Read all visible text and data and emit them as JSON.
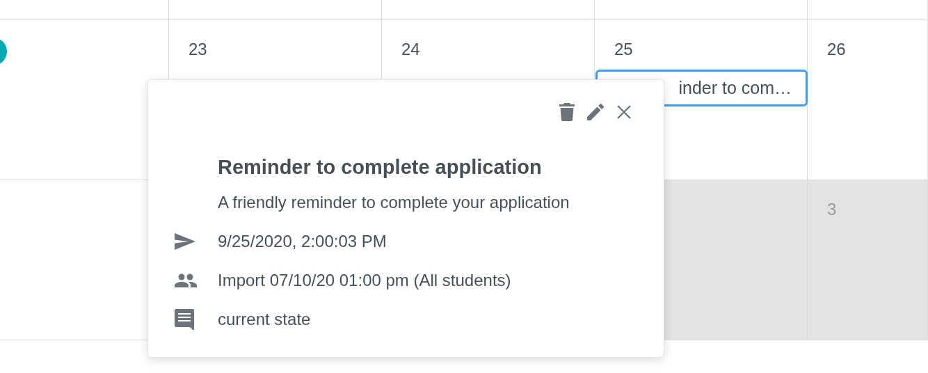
{
  "calendar": {
    "weeks": [
      {
        "cells": [
          {
            "outside": false
          },
          {
            "outside": false
          },
          {
            "outside": false
          },
          {
            "outside": false
          },
          {
            "outside": false
          }
        ]
      },
      {
        "cells": [
          {
            "outside": false,
            "marker": true
          },
          {
            "outside": false,
            "day": "23"
          },
          {
            "outside": false,
            "day": "24"
          },
          {
            "outside": false,
            "day": "25",
            "events": [
              {
                "title": "inder to com…",
                "selected": true
              }
            ]
          },
          {
            "outside": false,
            "day": "26"
          }
        ]
      },
      {
        "cells": [
          {
            "outside": false
          },
          {},
          {},
          {
            "outside": true
          },
          {
            "outside": true,
            "day": "3"
          }
        ]
      }
    ]
  },
  "popup": {
    "actions": [
      {
        "kind": "delete"
      },
      {
        "kind": "edit"
      },
      {
        "kind": "close"
      }
    ],
    "title": "Reminder to complete application",
    "description": "A friendly reminder to complete your application",
    "details": [
      {
        "kind": "sent",
        "text": "9/25/2020, 2:00:03 PM"
      },
      {
        "kind": "recipients",
        "text": "Import 07/10/20 01:00 pm (All students)"
      },
      {
        "kind": "note",
        "text": "current state"
      }
    ]
  }
}
